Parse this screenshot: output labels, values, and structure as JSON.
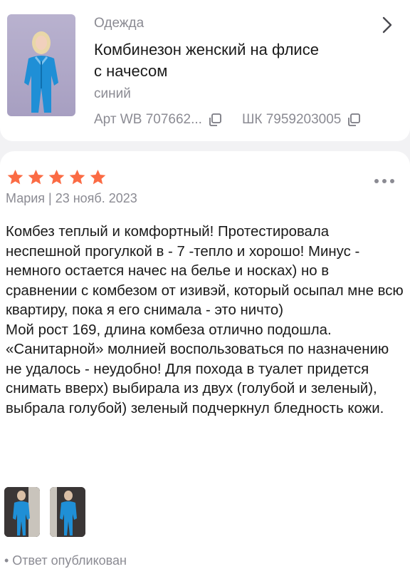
{
  "product": {
    "category": "Одежда",
    "title_line1": "Комбинезон женский на флисе",
    "title_line2": "с начесом",
    "color": "синий",
    "article": "Арт WB 707662...",
    "barcode": "ШК 7959203005",
    "thumbnail_icon": "woman-in-blue-jumpsuit"
  },
  "review": {
    "rating": 5,
    "meta": "Мария | 23 нояб. 2023",
    "paragraph1": "Комбез теплый и комфортный! Протестировала неспешной прогулкой в - 7 -тепло и хорошо! Минус - немного остается начес на белье и носках) но в сравнении с комбезом от изивэй, который осыпал мне всю квартиру, пока я его снимала - это ничто)",
    "paragraph2": "Мой рост 169, длина комбеза отлично подошла. «Санитарной» молнией воспользоваться по назначению не удалось - неудобно! Для похода в туалет придется снимать вверх) выбирала из двух (голубой и зеленый), выбрала голубой) зеленый подчеркнул бледность кожи.",
    "answer_status": "• Ответ опубликован"
  },
  "colors": {
    "star": "#fb6b44",
    "muted": "#8b8b93",
    "jumpsuit": "#1f8fd6"
  }
}
